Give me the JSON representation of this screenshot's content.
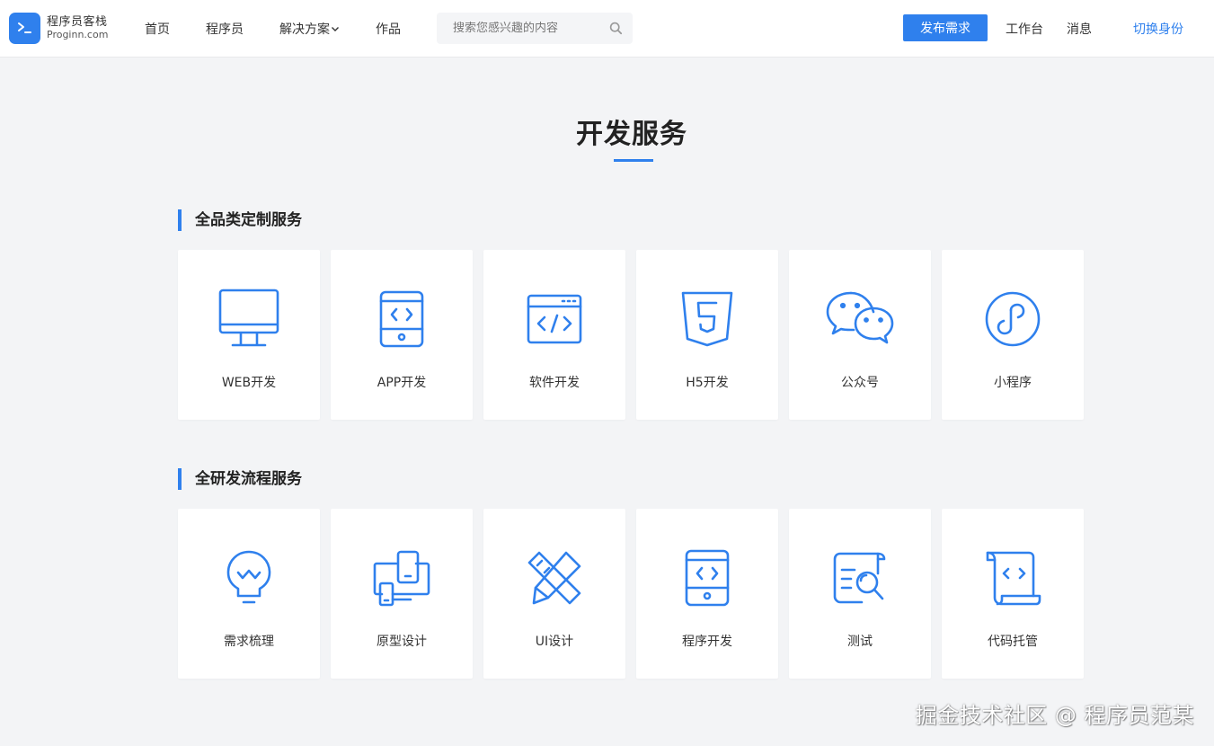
{
  "brand": {
    "name_cn": "程序员客栈",
    "name_en": "Proginn.com",
    "color": "#2f80ed"
  },
  "nav": {
    "items": [
      "首页",
      "程序员",
      "解决方案",
      "作品"
    ],
    "search_placeholder": "搜索您感兴趣的内容",
    "publish_label": "发布需求",
    "workspace_label": "工作台",
    "messages_label": "消息",
    "switch_identity_label": "切换身份"
  },
  "page": {
    "title": "开发服务"
  },
  "sections": [
    {
      "heading": "全品类定制服务",
      "cards": [
        {
          "label": "WEB开发",
          "icon": "monitor-icon"
        },
        {
          "label": "APP开发",
          "icon": "mobile-code-icon"
        },
        {
          "label": "软件开发",
          "icon": "browser-code-icon"
        },
        {
          "label": "H5开发",
          "icon": "html5-icon"
        },
        {
          "label": "公众号",
          "icon": "wechat-icon"
        },
        {
          "label": "小程序",
          "icon": "mini-program-icon"
        }
      ]
    },
    {
      "heading": "全研发流程服务",
      "cards": [
        {
          "label": "需求梳理",
          "icon": "lightbulb-icon"
        },
        {
          "label": "原型设计",
          "icon": "devices-icon"
        },
        {
          "label": "UI设计",
          "icon": "ruler-pencil-icon"
        },
        {
          "label": "程序开发",
          "icon": "mobile-code-icon"
        },
        {
          "label": "测试",
          "icon": "document-search-icon"
        },
        {
          "label": "代码托管",
          "icon": "scroll-code-icon"
        }
      ]
    }
  ],
  "watermark": "掘金技术社区 @ 程序员范某"
}
